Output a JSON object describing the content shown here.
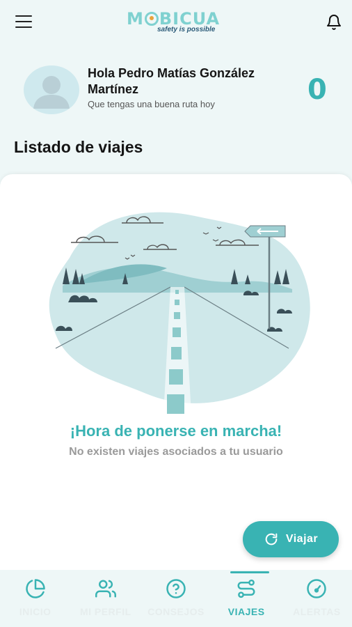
{
  "header": {
    "logo_text": "MOBICUA",
    "logo_prefix": "M",
    "logo_suffix": "BICUA",
    "tagline": "safety is possible"
  },
  "profile": {
    "greeting": "Hola Pedro Matías González Martínez",
    "subtitle": "Que tengas una buena ruta hoy",
    "score": "0"
  },
  "trips": {
    "section_title": "Listado de viajes",
    "empty_title": "¡Hora de ponerse en marcha!",
    "empty_subtitle": "No existen viajes asociados a tu usuario"
  },
  "fab": {
    "label": "Viajar",
    "icon": "refresh-icon"
  },
  "nav": [
    {
      "label": "INICIO",
      "icon": "pie-chart-icon",
      "active": false
    },
    {
      "label": "MI PERFIL",
      "icon": "users-icon",
      "active": false
    },
    {
      "label": "CONSEJOS",
      "icon": "help-circle-icon",
      "active": false
    },
    {
      "label": "VIAJES",
      "icon": "route-icon",
      "active": true
    },
    {
      "label": "ALERTAS",
      "icon": "gauge-icon",
      "active": false
    }
  ],
  "colors": {
    "accent": "#39b3b3",
    "logo": "#7fd1d0",
    "background": "#eef7f7",
    "card": "#ffffff",
    "inactive_nav": "#e6eded"
  }
}
